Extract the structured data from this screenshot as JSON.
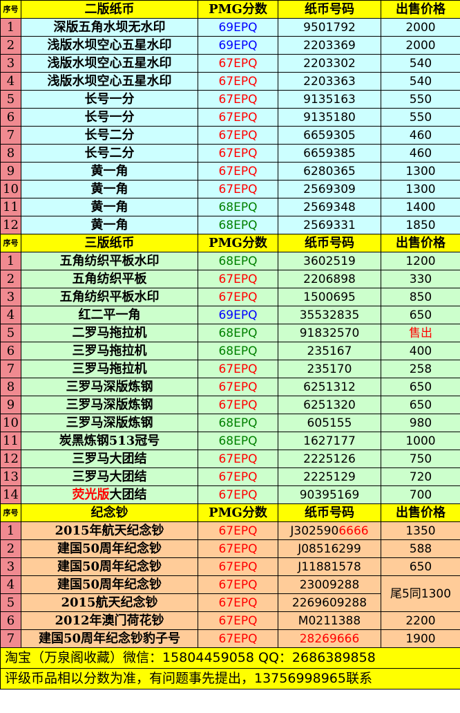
{
  "headers": {
    "index": "序号",
    "grade": "PMG分数",
    "serial": "纸币号码",
    "price": "出售价格"
  },
  "sections": [
    {
      "title": "二版纸币",
      "rows": [
        {
          "no": "1",
          "name": "深版五角水坝无水印",
          "grade": "69EPQ",
          "grade_color": "#0000ff",
          "serial": "9501792",
          "price": "2000"
        },
        {
          "no": "2",
          "name": "浅版水坝空心五星水印",
          "grade": "69EPQ",
          "grade_color": "#0000ff",
          "serial": "2203369",
          "price": "2000"
        },
        {
          "no": "3",
          "name": "浅版水坝空心五星水印",
          "grade": "67EPQ",
          "grade_color": "#ff0000",
          "serial": "2203302",
          "price": "540"
        },
        {
          "no": "4",
          "name": "浅版水坝空心五星水印",
          "grade": "67EPQ",
          "grade_color": "#ff0000",
          "serial": "2203363",
          "price": "540"
        },
        {
          "no": "5",
          "name": "长号一分",
          "grade": "67EPQ",
          "grade_color": "#ff0000",
          "serial": "9135163",
          "price": "550"
        },
        {
          "no": "6",
          "name": "长号一分",
          "grade": "67EPQ",
          "grade_color": "#ff0000",
          "serial": "9135180",
          "price": "550"
        },
        {
          "no": "7",
          "name": "长号二分",
          "grade": "67EPQ",
          "grade_color": "#ff0000",
          "serial": "6659305",
          "price": "460"
        },
        {
          "no": "8",
          "name": "长号二分",
          "grade": "67EPQ",
          "grade_color": "#ff0000",
          "serial": "6659385",
          "price": "460"
        },
        {
          "no": "9",
          "name": "黄一角",
          "grade": "67EPQ",
          "grade_color": "#ff0000",
          "serial": "6280365",
          "price": "1300"
        },
        {
          "no": "10",
          "name": "黄一角",
          "grade": "67EPQ",
          "grade_color": "#ff0000",
          "serial": "2569309",
          "price": "1300"
        },
        {
          "no": "11",
          "name": "黄一角",
          "grade": "68EPQ",
          "grade_color": "#008000",
          "serial": "2569348",
          "price": "1400"
        },
        {
          "no": "12",
          "name": "黄一角",
          "grade": "68EPQ",
          "grade_color": "#008000",
          "serial": "2569331",
          "price": "1850"
        }
      ]
    },
    {
      "title": "三版纸币",
      "rows": [
        {
          "no": "1",
          "name": "五角纺织平板水印",
          "grade": "68EPQ",
          "grade_color": "#008000",
          "serial": "3602519",
          "price": "1200"
        },
        {
          "no": "2",
          "name": "五角纺织平板",
          "grade": "67EPQ",
          "grade_color": "#ff0000",
          "serial": "2206898",
          "price": "330"
        },
        {
          "no": "3",
          "name": "五角纺织平板水印",
          "grade": "67EPQ",
          "grade_color": "#ff0000",
          "serial": "1500695",
          "price": "850"
        },
        {
          "no": "4",
          "name": "红二平一角",
          "grade": "69EPQ",
          "grade_color": "#0000ff",
          "serial": "35532835",
          "price": "650"
        },
        {
          "no": "5",
          "name": "二罗马拖拉机",
          "grade": "68EPQ",
          "grade_color": "#008000",
          "serial": "91832570",
          "price": "售出",
          "price_color": "#ff0000"
        },
        {
          "no": "6",
          "name": "三罗马拖拉机",
          "grade": "68EPQ",
          "grade_color": "#008000",
          "serial": "235167",
          "price": "400"
        },
        {
          "no": "7",
          "name": "三罗马拖拉机",
          "grade": "67EPQ",
          "grade_color": "#ff0000",
          "serial": "235170",
          "price": "258"
        },
        {
          "no": "8",
          "name": "三罗马深版炼钢",
          "grade": "67EPQ",
          "grade_color": "#ff0000",
          "serial": "6251312",
          "price": "650"
        },
        {
          "no": "9",
          "name": "三罗马深版炼钢",
          "grade": "67EPQ",
          "grade_color": "#ff0000",
          "serial": "6251320",
          "price": "650"
        },
        {
          "no": "10",
          "name": "三罗马深版炼钢",
          "grade": "68EPQ",
          "grade_color": "#008000",
          "serial": "605155",
          "price": "980"
        },
        {
          "no": "11",
          "name": "炭黑炼钢513冠号",
          "grade": "68EPQ",
          "grade_color": "#008000",
          "serial": "1627177",
          "price": "1000"
        },
        {
          "no": "12",
          "name": "三罗马大团结",
          "grade": "67EPQ",
          "grade_color": "#ff0000",
          "serial": "2225126",
          "price": "750"
        },
        {
          "no": "13",
          "name": "三罗马大团结",
          "grade": "67EPQ",
          "grade_color": "#ff0000",
          "serial": "2225129",
          "price": "720"
        },
        {
          "no": "14",
          "name_red": "荧光版",
          "name": "大团结",
          "grade": "67EPQ",
          "grade_color": "#ff0000",
          "serial": "90395169",
          "price": "700"
        }
      ]
    },
    {
      "title": "纪念钞",
      "rows": [
        {
          "no": "1",
          "name": "2015年航天纪念钞",
          "grade": "67EPQ",
          "grade_color": "#ff0000",
          "serial": "J302590",
          "serial_red": "6666",
          "price": "1350"
        },
        {
          "no": "2",
          "name": "建国50周年纪念钞",
          "grade": "67EPQ",
          "grade_color": "#ff0000",
          "serial": "J08516299",
          "price": "588"
        },
        {
          "no": "3",
          "name": "建国50周年纪念钞",
          "grade": "67EPQ",
          "grade_color": "#ff0000",
          "serial": "J11881578",
          "price": "650"
        },
        {
          "no": "4",
          "name": "建国50周年纪念钞",
          "grade": "67EPQ",
          "grade_color": "#ff0000",
          "serial": "23009288",
          "price": "尾5同1300",
          "price_rowspan": 2
        },
        {
          "no": "5",
          "name": "2015航天纪念钞",
          "grade": "67EPQ",
          "grade_color": "#ff0000",
          "serial": "2269609288"
        },
        {
          "no": "6",
          "name": "2012年澳门荷花钞",
          "grade": "67EPQ",
          "grade_color": "#ff0000",
          "serial": "M0211388",
          "price": "2200"
        },
        {
          "no": "7",
          "name": "建国50周年纪念钞豹子号",
          "grade": "67EPQ",
          "grade_color": "#ff0000",
          "serial": "28269666",
          "serial_color": "#ff0000",
          "price": "1900"
        }
      ]
    }
  ],
  "footer": {
    "line1": "淘宝（万泉阁收藏）微信：15804459058 QQ：2686389858",
    "line2": "评级币品相以分数为准，有问题事先提出，13756998965联系"
  },
  "colors": {
    "index_bg": "#f08a90",
    "header_bg": "#ffff00",
    "section1_bg": "#ccffff",
    "section2_bg": "#ccffcc",
    "section3_bg": "#ffcc99"
  }
}
